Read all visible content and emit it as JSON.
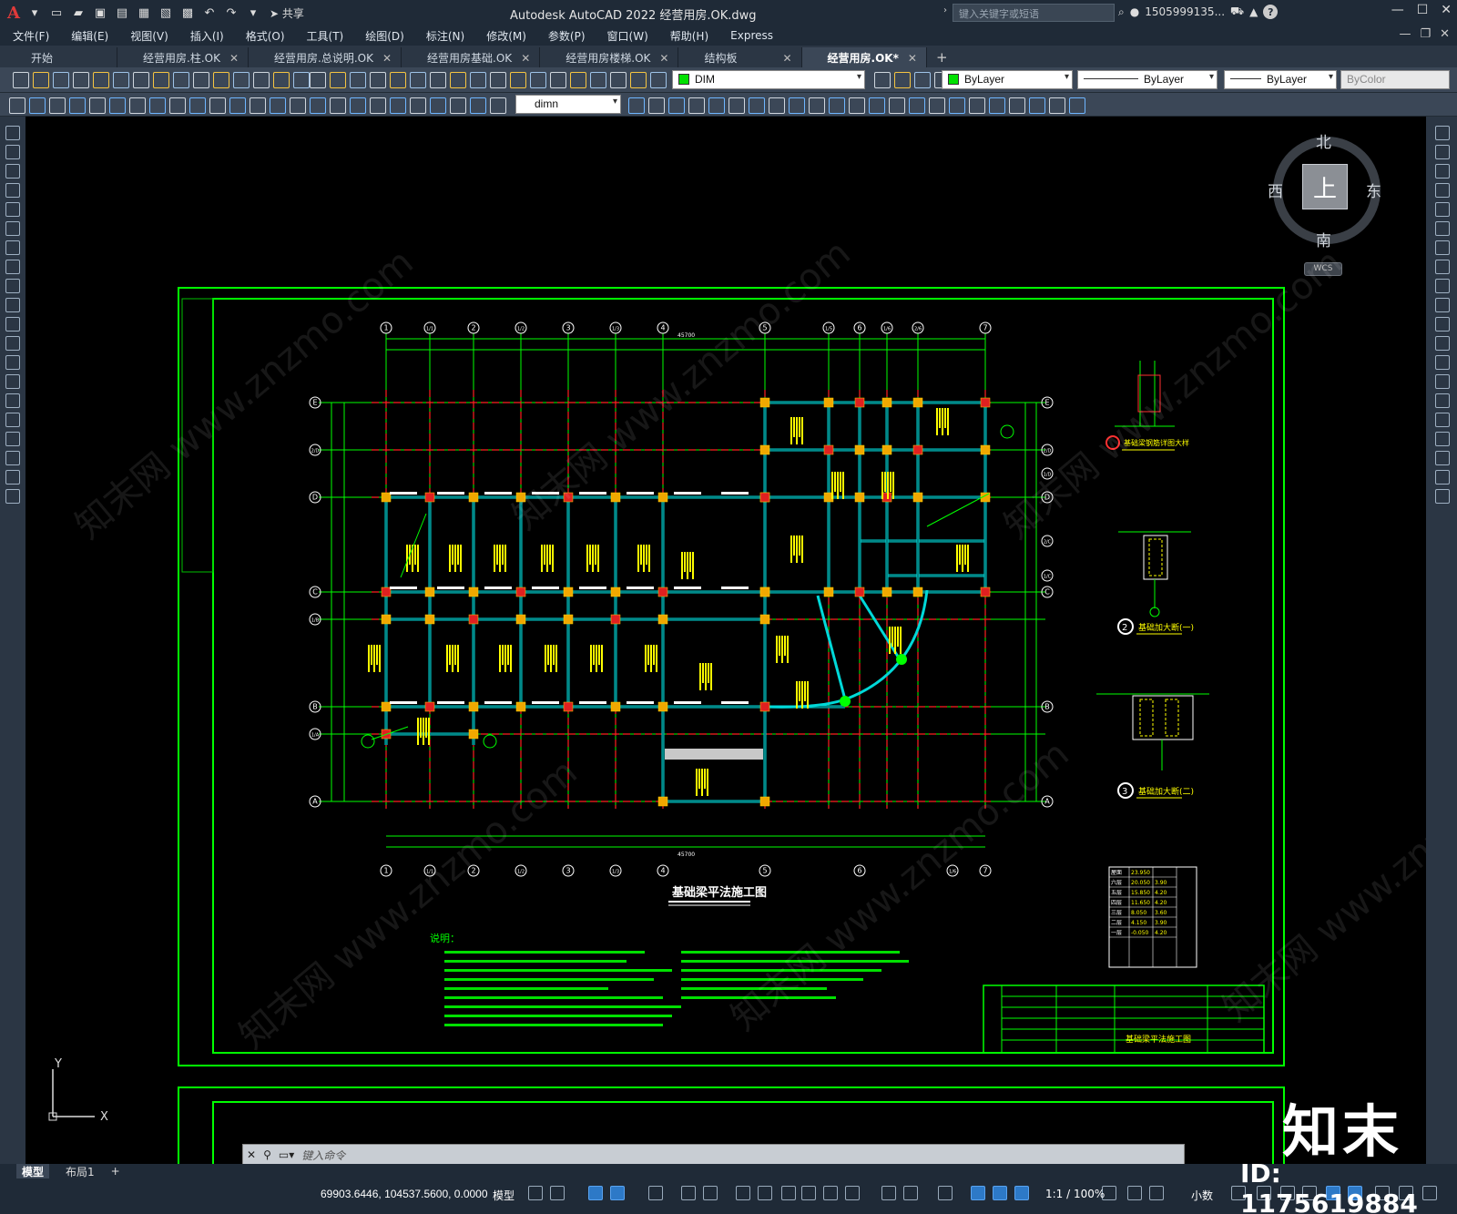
{
  "titlebar": {
    "app_letter": "A",
    "share_label": "共享",
    "title": "Autodesk AutoCAD 2022    经营用房.OK.dwg",
    "search_placeholder": "键入关键字或短语",
    "user": "1505999135...",
    "help": "?"
  },
  "menu": {
    "items": [
      "文件(F)",
      "编辑(E)",
      "视图(V)",
      "插入(I)",
      "格式(O)",
      "工具(T)",
      "绘图(D)",
      "标注(N)",
      "修改(M)",
      "参数(P)",
      "窗口(W)",
      "帮助(H)",
      "Express"
    ]
  },
  "tabs": {
    "items": [
      {
        "label": "开始",
        "active": false,
        "closable": false
      },
      {
        "label": "经营用房.柱.OK",
        "active": false,
        "closable": true
      },
      {
        "label": "经营用房.总说明.OK",
        "active": false,
        "closable": true
      },
      {
        "label": "经营用房基础.OK",
        "active": false,
        "closable": true
      },
      {
        "label": "经营用房楼梯.OK",
        "active": false,
        "closable": true
      },
      {
        "label": "结构板",
        "active": false,
        "closable": true
      },
      {
        "label": "经营用房.OK*",
        "active": true,
        "closable": true
      }
    ],
    "add": "+"
  },
  "toolbar": {
    "layer_value": "DIM",
    "color_value": "ByLayer",
    "linetype_value": "ByLayer",
    "lineweight_value": "ByLayer",
    "plotstyle_value": "ByColor",
    "dimstyle_value": "dimn"
  },
  "viewcube": {
    "north": "北",
    "south": "南",
    "east": "东",
    "west": "西",
    "top": "上",
    "wcs": "WCS"
  },
  "drawing": {
    "plan_title": "基础梁平法施工图",
    "notes_title": "说明：",
    "detail2_title": "基础加大断(一)",
    "detail3_title": "基础加大断(二)",
    "detail1_title": "基础梁钢筋详图大样",
    "title_block_name": "基础梁平法施工图",
    "overall_dim": "45700",
    "grid_top": [
      "1",
      "1/1",
      "2",
      "1/2",
      "3",
      "1/3",
      "4",
      "5",
      "1/5",
      "6",
      "1/6",
      "2/6",
      "7"
    ],
    "grid_bottom": [
      "1",
      "1/1",
      "2",
      "1/2",
      "3",
      "1/3",
      "4",
      "5",
      "6",
      "1/6",
      "7"
    ],
    "grid_rows": [
      "E",
      "2/D",
      "D",
      "C",
      "1/B",
      "B",
      "1/A",
      "A"
    ],
    "grid_rows_right": [
      "E",
      "2/D",
      "1/D",
      "D",
      "2/C",
      "1/C",
      "C",
      "B",
      "A"
    ],
    "level_table": [
      [
        "屋面",
        "23.950",
        ""
      ],
      [
        "六层",
        "20.050",
        "3.90"
      ],
      [
        "五层",
        "15.850",
        "4.20"
      ],
      [
        "四层",
        "11.650",
        "4.20"
      ],
      [
        "三层",
        "8.050",
        "3.60"
      ],
      [
        "二层",
        "4.150",
        "3.90"
      ],
      [
        "一层",
        "-0.050",
        "4.20"
      ]
    ]
  },
  "command": {
    "placeholder": "键入命令"
  },
  "layout_tabs": [
    "模型",
    "布局1",
    "+"
  ],
  "status": {
    "coords": "69903.6446, 104537.5600, 0.0000",
    "model": "模型",
    "scale": "1:1 / 100%",
    "units": "小数"
  },
  "watermark": {
    "logo": "知末",
    "id": "ID: 1175619884",
    "site": "znzmo.com",
    "site2": "知末网 www.znzmo.com"
  }
}
